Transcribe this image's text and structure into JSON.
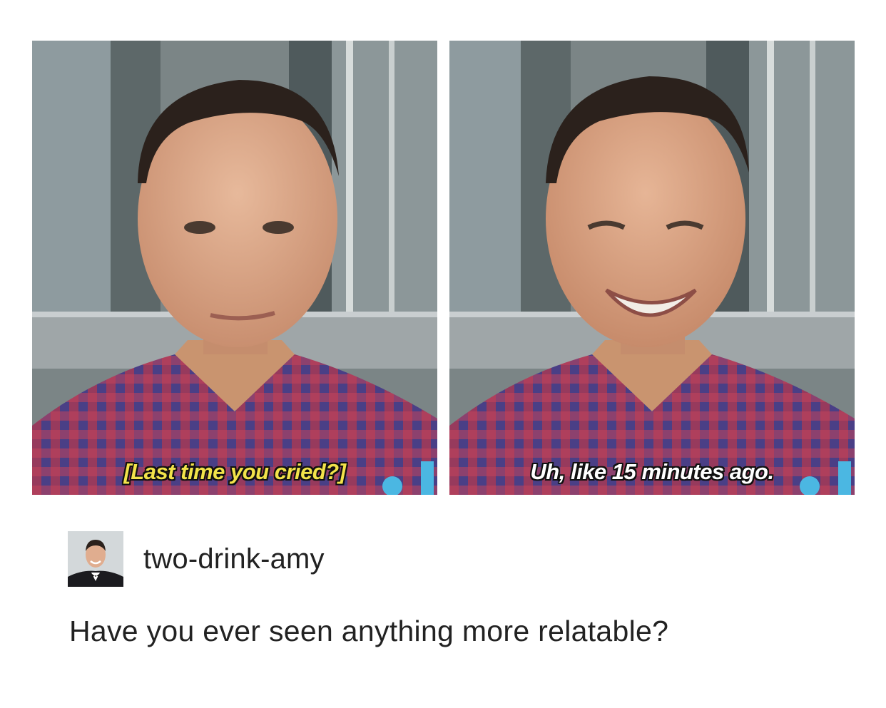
{
  "post": {
    "panels": [
      {
        "caption": "[Last time you cried?]"
      },
      {
        "caption": "Uh, like 15 minutes ago."
      }
    ],
    "username": "two-drink-amy",
    "text": "Have you ever seen anything more relatable?"
  },
  "colors": {
    "caption_left": "#f2e34a",
    "caption_right": "#ffffff",
    "text": "#222222",
    "background": "#ffffff"
  }
}
